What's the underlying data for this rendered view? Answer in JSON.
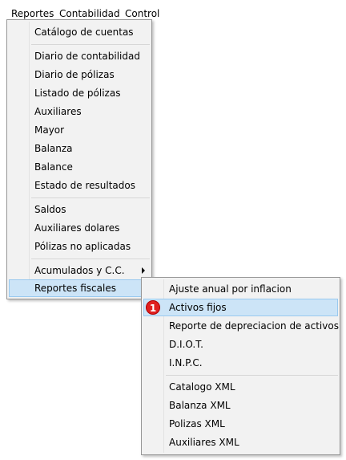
{
  "menubar": {
    "items": [
      {
        "label": "Reportes"
      },
      {
        "label": "Contabilidad"
      },
      {
        "label": "Control"
      }
    ]
  },
  "menu_reportes": {
    "items": [
      {
        "label": "Catálogo de cuentas"
      },
      {
        "label": "Diario de contabilidad"
      },
      {
        "label": "Diario de pólizas"
      },
      {
        "label": "Listado de pólizas"
      },
      {
        "label": "Auxiliares"
      },
      {
        "label": "Mayor"
      },
      {
        "label": "Balanza"
      },
      {
        "label": "Balance"
      },
      {
        "label": "Estado de resultados"
      },
      {
        "label": "Saldos"
      },
      {
        "label": "Auxiliares dolares"
      },
      {
        "label": "Pólizas no aplicadas"
      },
      {
        "label": "Acumulados y C.C."
      },
      {
        "label": "Reportes fiscales"
      }
    ]
  },
  "submenu_reportes_fiscales": {
    "items": [
      {
        "label": "Ajuste anual por inflacion"
      },
      {
        "label": "Activos fijos",
        "badge": "1"
      },
      {
        "label": "Reporte de depreciacion de activos"
      },
      {
        "label": "D.I.O.T."
      },
      {
        "label": "I.N.P.C."
      },
      {
        "label": "Catalogo XML"
      },
      {
        "label": "Balanza XML"
      },
      {
        "label": "Polizas XML"
      },
      {
        "label": "Auxiliares XML"
      }
    ]
  },
  "colors": {
    "menu_bg": "#f2f2f2",
    "highlight_bg": "#cce4f7",
    "highlight_border": "#99c9ef",
    "badge_bg": "#e0201f"
  }
}
